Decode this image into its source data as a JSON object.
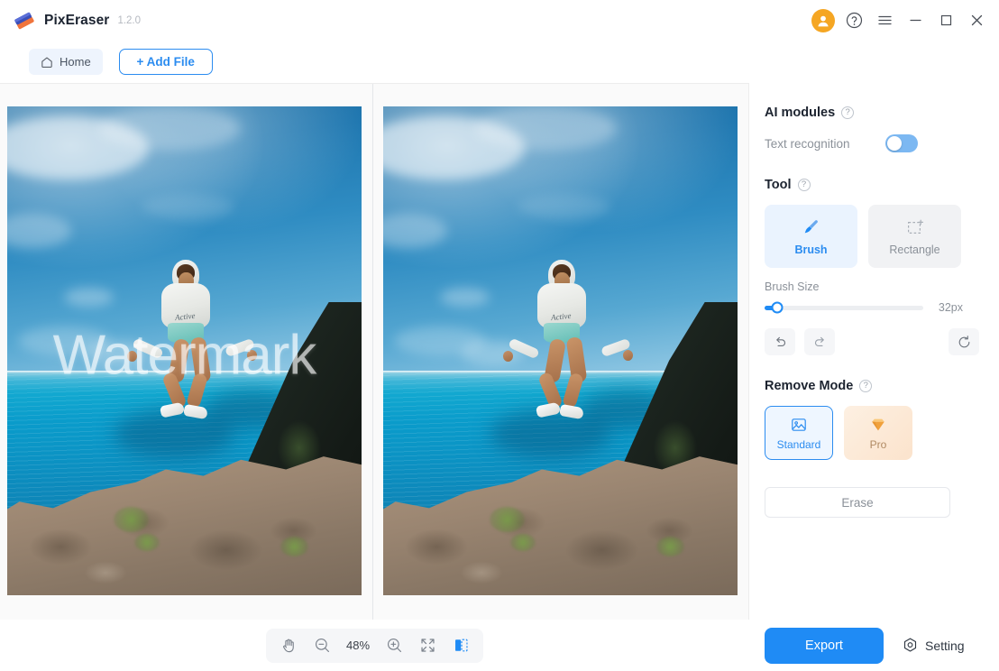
{
  "app": {
    "name": "PixEraser",
    "version": "1.2.0",
    "logo_icon": "eraser-logo-icon",
    "logo_colors": {
      "top": "#3b4fb8",
      "bottom": "#f0743c"
    }
  },
  "titlebar": {
    "account_icon": "user-avatar-icon",
    "help_icon": "help-circle-icon",
    "menu_icon": "hamburger-menu-icon",
    "minimize_icon": "minimize-icon",
    "maximize_icon": "maximize-icon",
    "close_icon": "close-icon"
  },
  "subheader": {
    "home_label": "Home",
    "home_icon": "home-icon",
    "add_file_label": "+ Add File"
  },
  "canvas": {
    "before": {
      "watermark_text": "Watermark",
      "description": "Person in white hoodie jumping off a rocky cliff over turquoise ocean water under a blue sky",
      "hoodie_logo": "Active"
    },
    "after": {
      "description": "Same photo with the watermark removed"
    }
  },
  "bottom_toolbar": {
    "pan_icon": "hand-pan-icon",
    "zoom_out_icon": "zoom-out-icon",
    "zoom_level": "48%",
    "zoom_in_icon": "zoom-in-icon",
    "fit_screen_icon": "fit-to-screen-icon",
    "compare_icon": "split-compare-icon"
  },
  "right_panel": {
    "ai_modules": {
      "title": "AI modules",
      "help_icon": "help-circle-icon",
      "text_recognition_label": "Text recognition",
      "text_recognition_enabled": true
    },
    "tool": {
      "title": "Tool",
      "help_icon": "help-circle-icon",
      "options": [
        {
          "label": "Brush",
          "icon": "paintbrush-icon",
          "selected": true
        },
        {
          "label": "Rectangle",
          "icon": "dashed-rectangle-icon",
          "selected": false
        }
      ],
      "brush_size_label": "Brush Size",
      "brush_size_value": "32px",
      "brush_size_percent": 8
    },
    "history": {
      "undo_icon": "undo-arrow-icon",
      "redo_icon": "redo-arrow-icon",
      "reset_icon": "reset-circular-arrow-icon"
    },
    "remove_mode": {
      "title": "Remove Mode",
      "help_icon": "help-circle-icon",
      "options": [
        {
          "label": "Standard",
          "icon": "image-picture-icon",
          "selected": true
        },
        {
          "label": "Pro",
          "icon": "diamond-gem-icon",
          "selected": false
        }
      ],
      "erase_label": "Erase"
    },
    "footer": {
      "export_label": "Export",
      "setting_label": "Setting",
      "setting_icon": "hexagon-gear-icon"
    }
  },
  "colors": {
    "accent_blue": "#1f8bf5",
    "accent_blue_light": "#eaf3fe",
    "pro_orange": "#f0a13c",
    "avatar_orange": "#F5A623",
    "panel_bg": "#ffffff",
    "canvas_bg": "#fafafa"
  }
}
